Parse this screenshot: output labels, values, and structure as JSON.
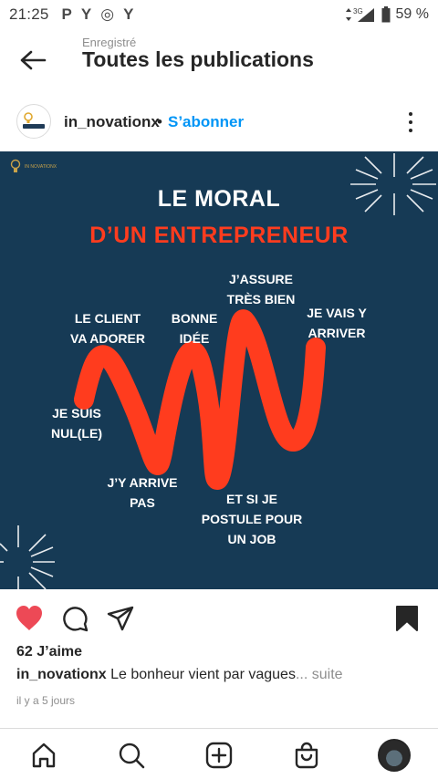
{
  "statusbar": {
    "time": "21:25",
    "notification_icons": [
      "P",
      "Y",
      "◎",
      "Y"
    ],
    "network": "3G",
    "battery": "59 %"
  },
  "header": {
    "subtitle": "Enregistré",
    "title": "Toutes les publications"
  },
  "post": {
    "username": "in_novationx",
    "separator": "•",
    "follow_label": "S’abonner",
    "avatar_text": "IN NOVATIONX",
    "image": {
      "title_line1": "LE MORAL",
      "title_line2": "D’UN ENTREPRENEUR",
      "logo_text": "IN NOVATIONX",
      "labels": {
        "client": "LE CLIENT\nVA ADORER",
        "nul": "JE SUIS\nNUL(LE)",
        "jarrive": "J’Y ARRIVE\nPAS",
        "bonne": "BONNE\nIDÉE",
        "etsi": "ET SI JE\nPOSTULE POUR\nUN JOB",
        "jassure": "J’ASSURE\nTRÈS BIEN",
        "jevais": "JE VAIS Y\nARRIVER"
      },
      "colors": {
        "background": "#163a55",
        "accent": "#ff3c1e"
      }
    },
    "likes": "62 J’aime",
    "caption_user": "in_novationx",
    "caption_text": " Le bonheur vient par vagues",
    "caption_more": "... suite",
    "date": "il y a 5 jours",
    "liked": true,
    "saved": true
  },
  "icons": {
    "back": "arrow-left-icon",
    "more": "more-vertical-icon",
    "like": "heart-icon",
    "comment": "comment-icon",
    "share": "send-icon",
    "save": "bookmark-icon",
    "home": "home-icon",
    "search": "search-icon",
    "create": "add-post-icon",
    "shop": "shop-icon",
    "profile": "profile-avatar"
  }
}
